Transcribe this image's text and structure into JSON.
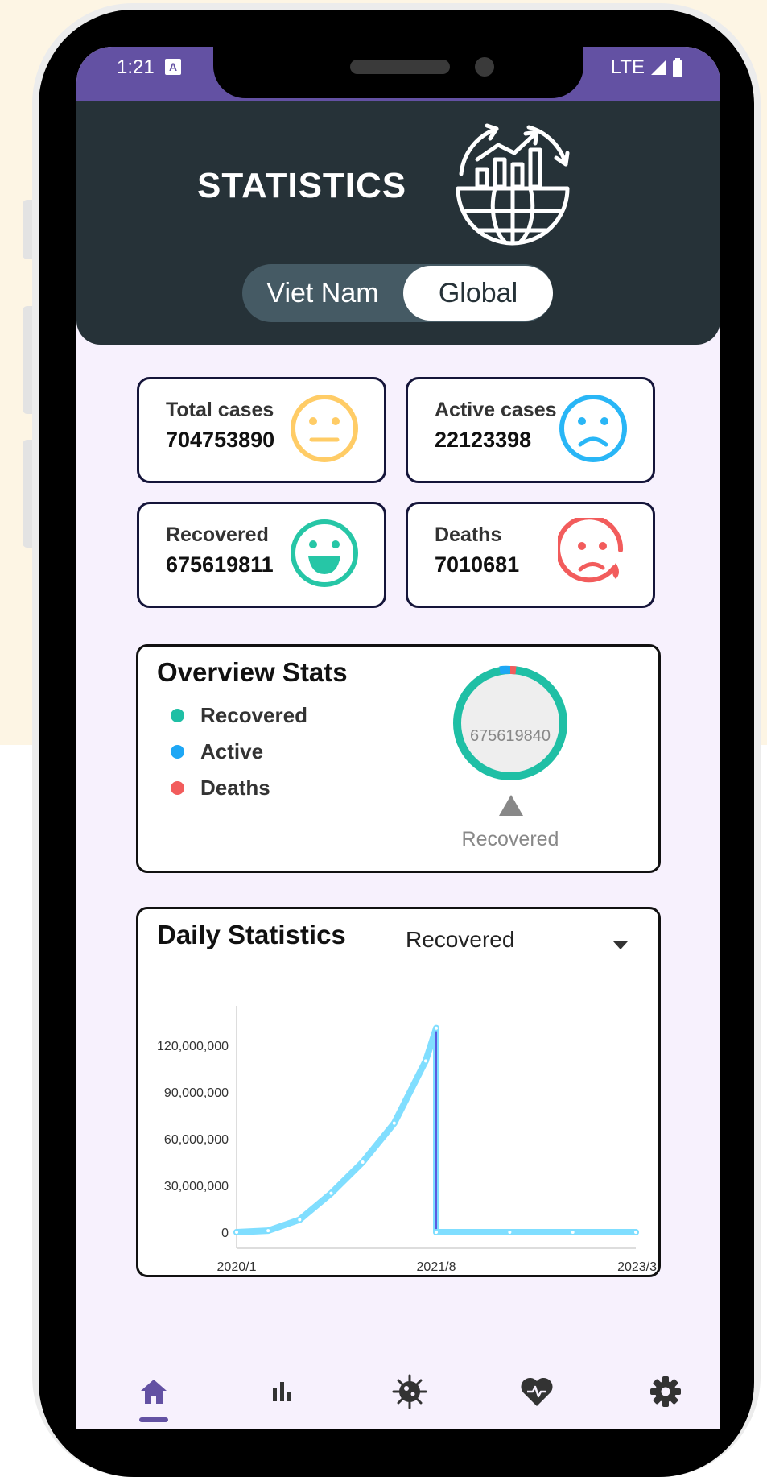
{
  "status_bar": {
    "time": "1:21",
    "network": "LTE",
    "color": "#6351a3"
  },
  "header": {
    "title": "STATISTICS",
    "icon": "globe-chart-icon",
    "toggle": {
      "options": [
        "Viet Nam",
        "Global"
      ],
      "selected": "Global"
    }
  },
  "cards": [
    {
      "label": "Total cases",
      "value": "704753890",
      "icon": "neutral-face-icon",
      "color": "#ffcc66"
    },
    {
      "label": "Active cases",
      "value": "22123398",
      "icon": "sad-face-icon",
      "color": "#29b6f6"
    },
    {
      "label": "Recovered",
      "value": "675619811",
      "icon": "happy-face-icon",
      "color": "#26c6a6"
    },
    {
      "label": "Deaths",
      "value": "7010681",
      "icon": "crying-face-icon",
      "color": "#f25c5c"
    }
  ],
  "overview": {
    "title": "Overview Stats",
    "legend": [
      {
        "label": "Recovered",
        "color": "#1fbfa5"
      },
      {
        "label": "Active",
        "color": "#1ea7f5"
      },
      {
        "label": "Deaths",
        "color": "#f25c5c"
      }
    ],
    "center_value": "675619840",
    "selected_caption": "Recovered"
  },
  "daily": {
    "title": "Daily Statistics",
    "dropdown_value": "Recovered",
    "chart_data": {
      "type": "line",
      "x": [
        "2020/1",
        "2020/4",
        "2020/7",
        "2020/10",
        "2021/1",
        "2021/4",
        "2021/7",
        "2021/8",
        "2021/8",
        "2022/3",
        "2022/9",
        "2023/3"
      ],
      "series": [
        {
          "values": [
            0,
            1000000,
            8000000,
            25000000,
            45000000,
            70000000,
            110000000,
            131000000,
            0,
            0,
            0,
            0
          ]
        }
      ],
      "tick_labels_x": [
        "2020/1",
        "2021/8",
        "2023/3"
      ],
      "tick_labels_y": [
        "0",
        "30,000,000",
        "60,000,000",
        "90,000,000",
        "120,000,000"
      ],
      "ylim": [
        0,
        135000000
      ],
      "line_color": "#80deff"
    }
  },
  "nav": {
    "items": [
      "home-icon",
      "bar-chart-icon",
      "virus-icon",
      "heart-pulse-icon",
      "gear-icon"
    ],
    "active": "home-icon"
  }
}
